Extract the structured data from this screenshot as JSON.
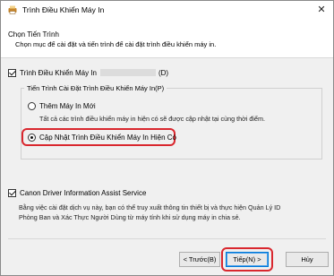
{
  "window": {
    "title": "Trình Điều Khiển Máy In",
    "close_symbol": "✕"
  },
  "header": {
    "title": "Chọn Tiến Trình",
    "subtitle": "Chọn mục để cài đặt và tiến trình để cài đặt trình điều khiển máy in."
  },
  "printer_driver": {
    "label": "Trình Điều Khiển Máy In",
    "suffix": "(D)",
    "checked": true
  },
  "install_process": {
    "legend": "Tiến Trình Cài Đặt Trình Điều Khiển Máy In(P)",
    "options": [
      {
        "label": "Thêm Máy In Mới",
        "description": "Tất cả các trình điều khiển máy in hiện có sẽ được cập nhật tại cùng thời điểm.",
        "selected": false
      },
      {
        "label": "Cập Nhật Trình Điều Khiển Máy In Hiện Có",
        "selected": true
      }
    ]
  },
  "assist_service": {
    "label": "Canon Driver Information Assist Service",
    "checked": true,
    "description_line1": "Bằng việc cài đặt dịch vụ này, bạn có thể truy xuất thông tin thiết bị và thực hiện Quản Lý ID",
    "description_line2": "Phòng Ban và Xác Thực Người Dùng từ máy tính khi sử dụng máy in chia sẻ."
  },
  "buttons": {
    "back": "< Trước(B)",
    "next": "Tiếp(N) >",
    "cancel": "Hủy"
  },
  "colors": {
    "highlight": "#d9272e",
    "primary_border": "#0078d7"
  }
}
